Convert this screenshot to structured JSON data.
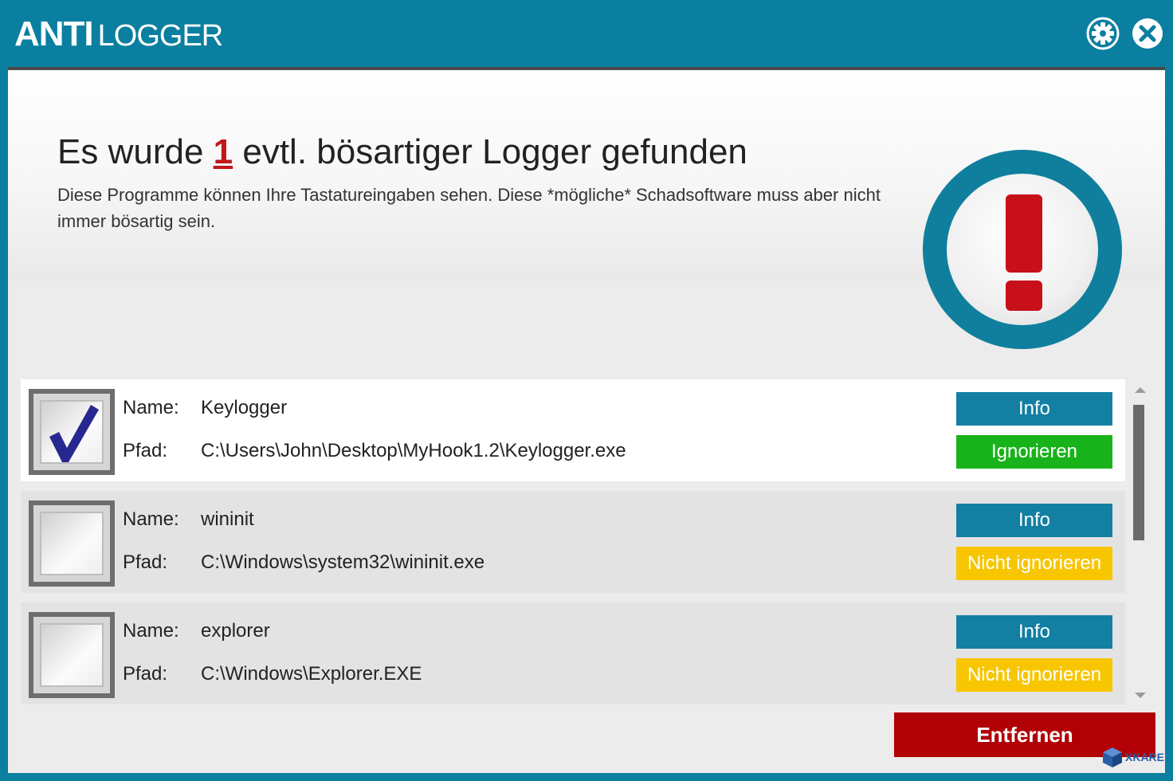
{
  "app": {
    "title_bold": "ANTI",
    "title_light": "LOGGER",
    "settings_icon": "gear-icon",
    "close_icon": "close-icon"
  },
  "header": {
    "headline_before": "Es wurde ",
    "headline_count": "1",
    "headline_after": " evtl. bösartiger Logger gefunden",
    "subtext": "Diese Programme können Ihre Tastatureingaben sehen. Diese *mögliche* Schadsoftware muss aber nicht immer bösartig sein.",
    "alert_icon": "exclamation-icon",
    "alert_color": "#c8101a",
    "ring_color": "#107f9d"
  },
  "labels": {
    "name": "Name:",
    "path": "Pfad:"
  },
  "items": [
    {
      "name": "Keylogger",
      "path": "C:\\Users\\John\\Desktop\\MyHook1.2\\Keylogger.exe",
      "checked": true,
      "info_label": "Info",
      "action_label": "Ignorieren"
    },
    {
      "name": "wininit",
      "path": "C:\\Windows\\system32\\wininit.exe",
      "checked": false,
      "info_label": "Info",
      "action_label": "Nicht ignorieren"
    },
    {
      "name": "explorer",
      "path": "C:\\Windows\\Explorer.EXE",
      "checked": false,
      "info_label": "Info",
      "action_label": "Nicht ignorieren"
    }
  ],
  "footer": {
    "remove_label": "Entfernen"
  },
  "watermark": {
    "text": "XKARE"
  },
  "colors": {
    "brand": "#0a7fa0",
    "info_button": "#137fa2",
    "ignore_button": "#18b31a",
    "not_ignore_button": "#f7c600",
    "remove_button": "#b10006"
  }
}
